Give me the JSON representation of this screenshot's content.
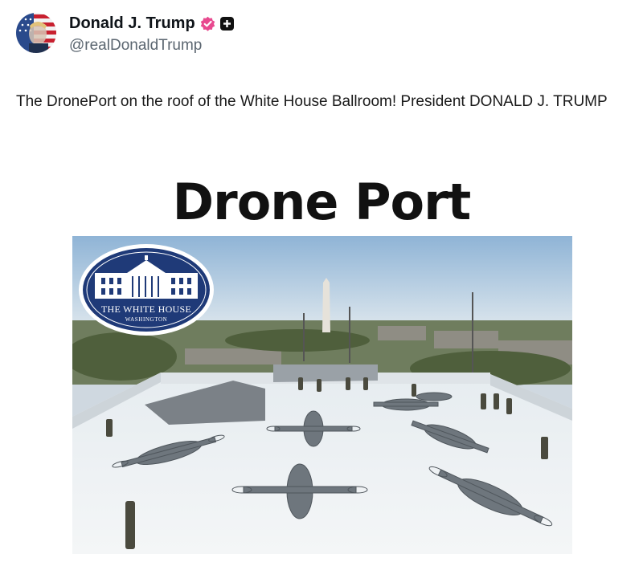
{
  "author": {
    "display_name": "Donald J. Trump",
    "handle": "@realDonaldTrump",
    "verified": true,
    "avatar_icon": "flag-portrait-avatar",
    "verified_icon": "verified-badge-icon",
    "plus_icon": "plus-badge-icon"
  },
  "post": {
    "text": "The DronePort on the roof of the White House Ballroom! President DONALD J. TRUMP"
  },
  "image": {
    "headline": "Drone Port",
    "seal": {
      "main": "THE WHITE HOUSE",
      "sub": "WASHINGTON"
    }
  },
  "colors": {
    "verified": "#e8498f",
    "seal_navy": "#1f3a78",
    "text_primary": "#0f1419",
    "text_secondary": "#5b6670"
  }
}
